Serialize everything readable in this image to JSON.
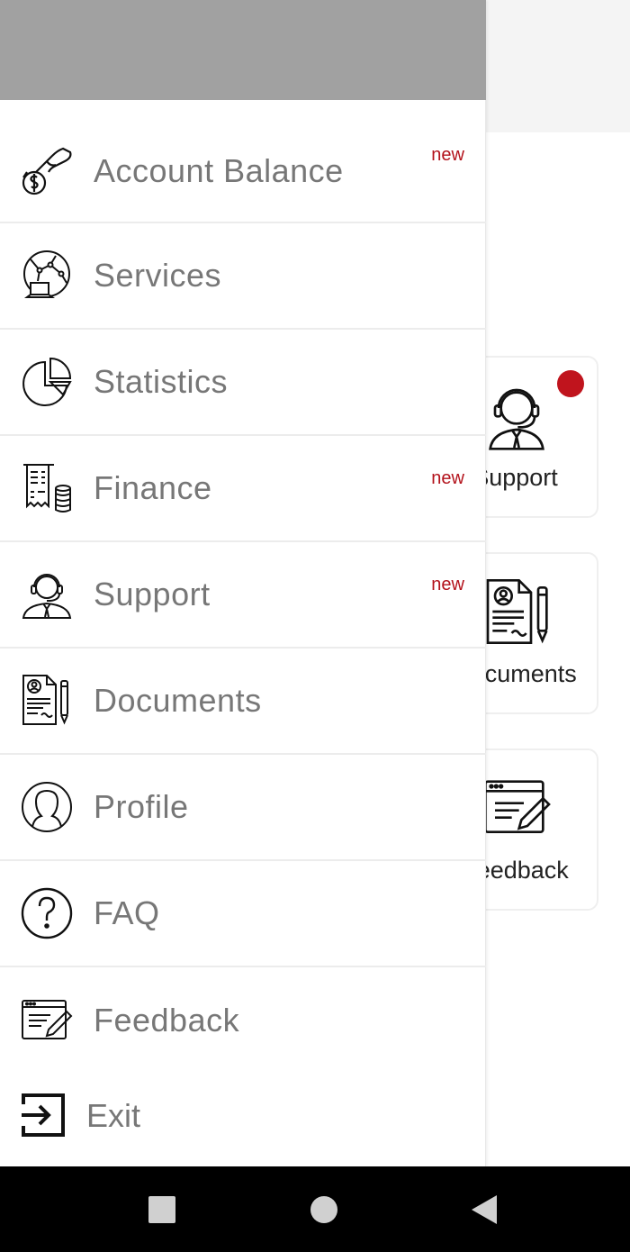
{
  "background": {
    "cards": [
      {
        "label": "Support",
        "icon": "support-agent-icon",
        "has_notification": true
      },
      {
        "label": "Documents",
        "icon": "documents-icon",
        "has_notification": false
      },
      {
        "label": "Feedback",
        "icon": "feedback-icon",
        "has_notification": false
      }
    ]
  },
  "drawer": {
    "items": [
      {
        "label": "Account Balance",
        "icon": "hand-coin-icon",
        "badge": "new"
      },
      {
        "label": "Services",
        "icon": "globe-laptop-icon",
        "badge": ""
      },
      {
        "label": "Statistics",
        "icon": "pie-chart-icon",
        "badge": ""
      },
      {
        "label": "Finance",
        "icon": "receipt-coins-icon",
        "badge": "new"
      },
      {
        "label": "Support",
        "icon": "support-agent-icon",
        "badge": "new"
      },
      {
        "label": "Documents",
        "icon": "documents-icon",
        "badge": ""
      },
      {
        "label": "Profile",
        "icon": "profile-icon",
        "badge": ""
      },
      {
        "label": "FAQ",
        "icon": "question-icon",
        "badge": ""
      },
      {
        "label": "Feedback",
        "icon": "feedback-icon",
        "badge": ""
      }
    ],
    "exit_label": "Exit"
  },
  "colors": {
    "accent": "#b3121b",
    "header_gray": "#a1a1a1",
    "label_gray": "#777777"
  }
}
